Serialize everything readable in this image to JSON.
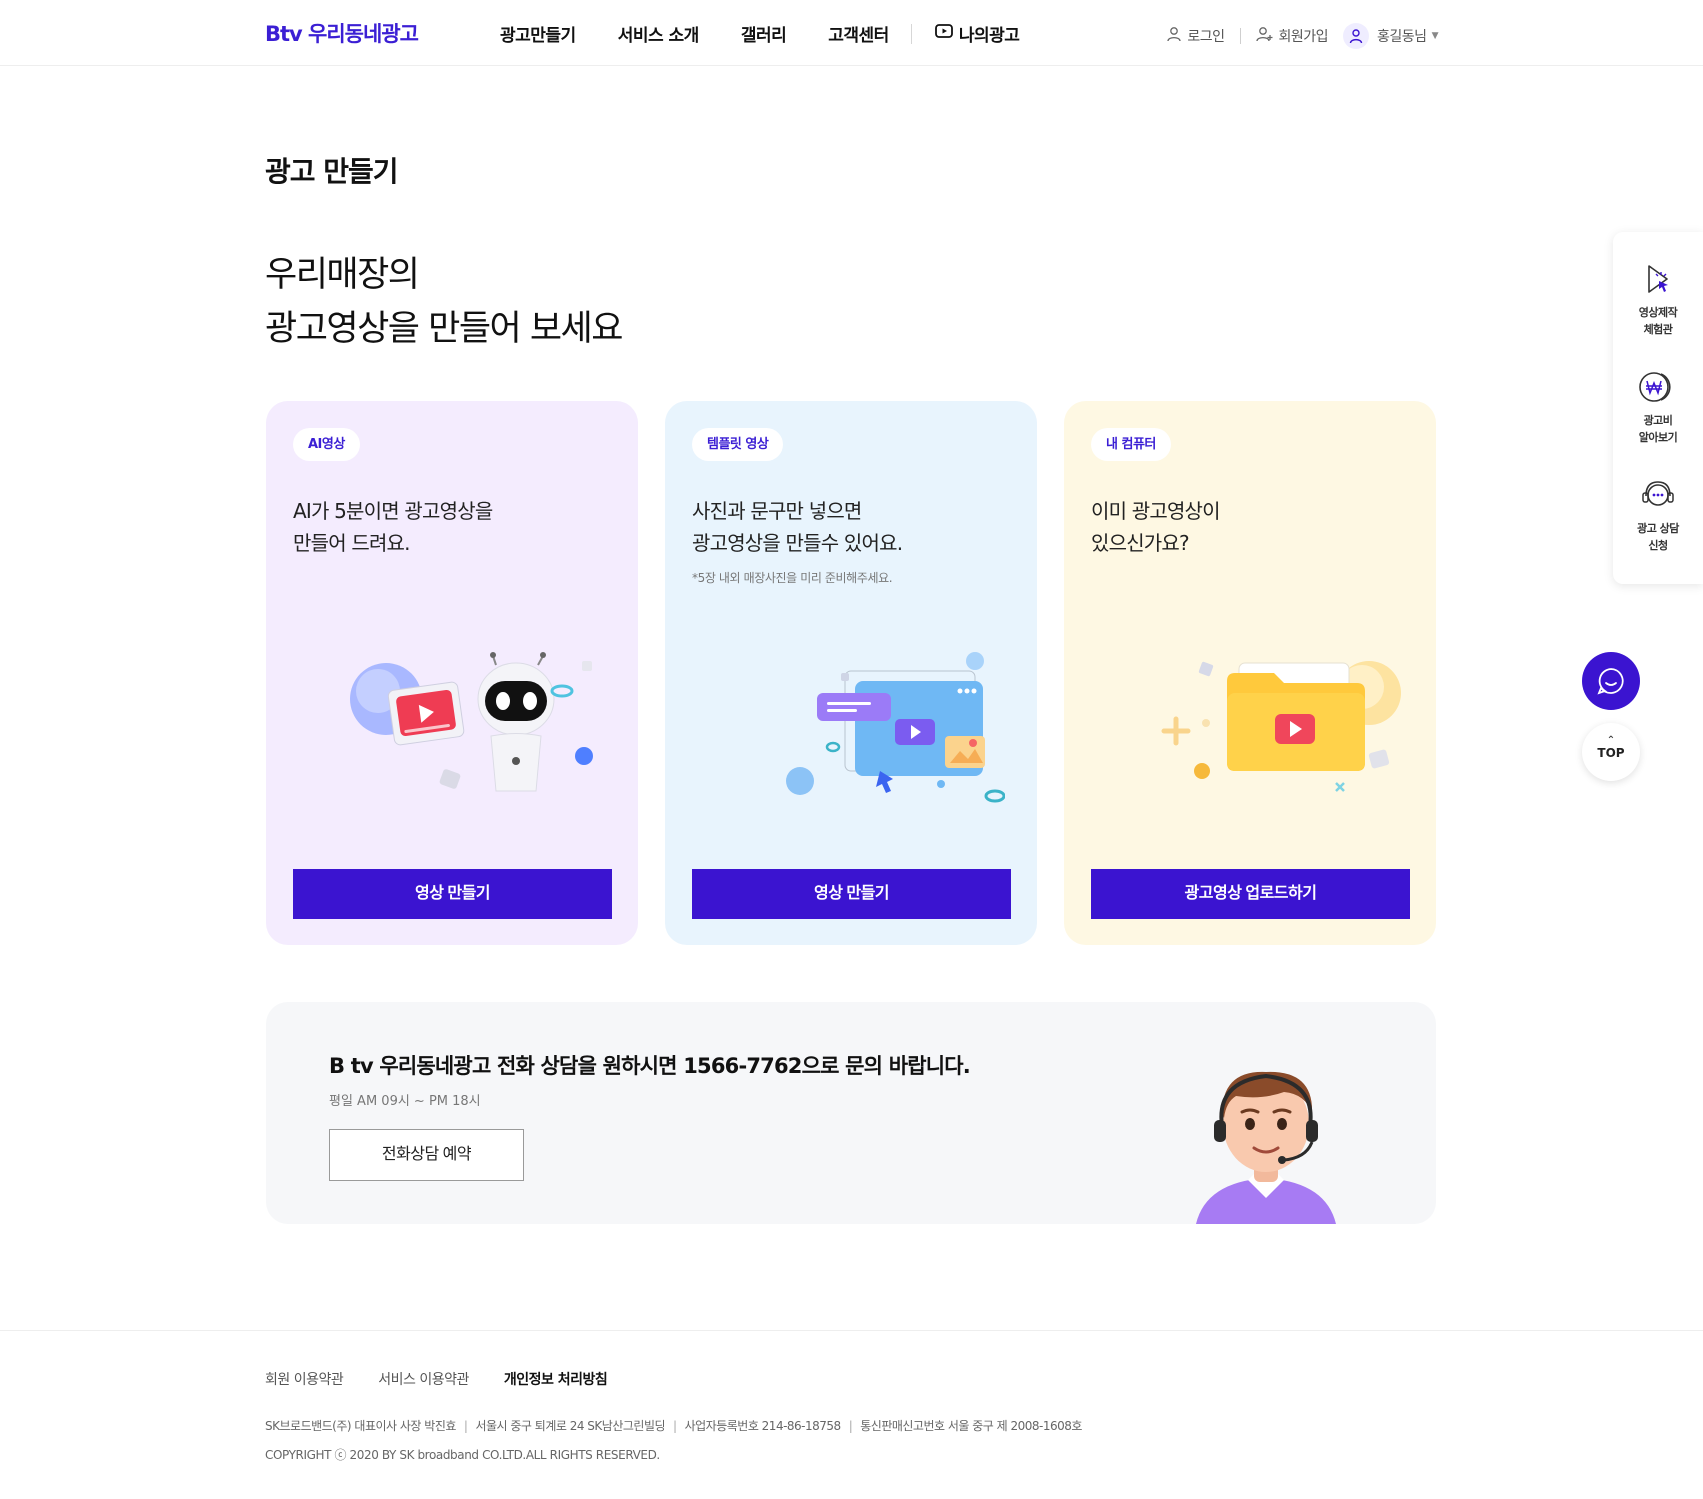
{
  "header": {
    "logo": "Btv 우리동네광고",
    "nav": [
      "광고만들기",
      "서비스 소개",
      "갤러리",
      "고객센터"
    ],
    "my_ad": "나의광고",
    "login": "로그인",
    "signup": "회원가입",
    "user": "홍길동님"
  },
  "page": {
    "title": "광고 만들기",
    "hero_line1": "우리매장의",
    "hero_line2": "광고영상을 만들어 보세요"
  },
  "cards": [
    {
      "badge": "AI영상",
      "line1": "AI가 5분이면 광고영상을",
      "line2": "만들어 드려요.",
      "note": "",
      "button": "영상 만들기",
      "illustration": "robot-video-illustration"
    },
    {
      "badge": "템플릿 영상",
      "line1": "사진과 문구만 넣으면",
      "line2": "광고영상을 만들수 있어요.",
      "note": "*5장 내외 매장사진을 미리 준비해주세요.",
      "button": "영상 만들기",
      "illustration": "template-editor-illustration"
    },
    {
      "badge": "내 컴퓨터",
      "line1": "이미 광고영상이",
      "line2": "있으신가요?",
      "note": "",
      "button": "광고영상 업로드하기",
      "illustration": "video-folder-illustration"
    }
  ],
  "banner": {
    "title": "B tv 우리동네광고 전화 상담을 원하시면 1566-7762으로 문의 바랍니다.",
    "hours": "평일 AM 09시 ~ PM 18시",
    "button": "전화상담 예약"
  },
  "quick_menu": [
    {
      "line1": "영상제작",
      "line2": "체험관",
      "icon": "cursor-click-icon"
    },
    {
      "line1": "광고비",
      "line2": "알아보기",
      "icon": "won-coin-icon"
    },
    {
      "line1": "광고 상담",
      "line2": "신청",
      "icon": "headset-chat-icon"
    }
  ],
  "floating": {
    "top_label": "TOP",
    "chat_icon": "chatbot-icon"
  },
  "footer": {
    "links": [
      "회원 이용약관",
      "서비스 이용약관",
      "개인정보 처리방침"
    ],
    "info": [
      "SK브로드밴드(주) 대표이사 사장 박진효",
      "서울시 중구 퇴계로 24 SK남산그린빌딩",
      "사업자등록번호 214-86-18758",
      "통신판매신고번호 서울 중구 제 2008-1608호"
    ],
    "copyright": "COPYRIGHT ⓒ 2020 BY SK broadband CO.LTD.ALL RIGHTS RESERVED."
  },
  "colors": {
    "accent": "#3b14d0",
    "card_ai_bg": "#f4ecfe",
    "card_template_bg": "#e8f4fd",
    "card_upload_bg": "#fef8e3",
    "banner_bg": "#f6f7f9"
  }
}
